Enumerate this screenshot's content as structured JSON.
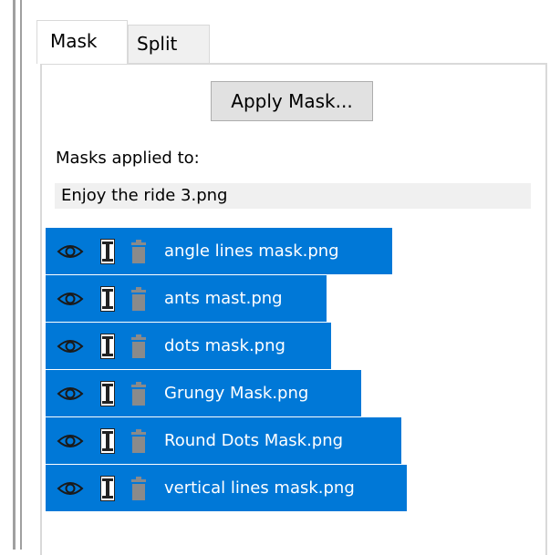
{
  "tabs": [
    {
      "label": "Mask",
      "active": true
    },
    {
      "label": "Split",
      "active": false
    }
  ],
  "apply_button": {
    "label": "Apply Mask..."
  },
  "applied_label": "Masks applied to:",
  "target_file": "Enjoy the ride 3.png",
  "selection_color": "#0078d7",
  "masks": [
    {
      "name": "angle lines mask.png"
    },
    {
      "name": "ants mast.png"
    },
    {
      "name": "dots mask.png"
    },
    {
      "name": "Grungy Mask.png"
    },
    {
      "name": "Round Dots Mask.png"
    },
    {
      "name": "vertical lines mask.png"
    }
  ],
  "row_icons": [
    "eye-icon",
    "text-cursor-icon",
    "trash-icon"
  ]
}
